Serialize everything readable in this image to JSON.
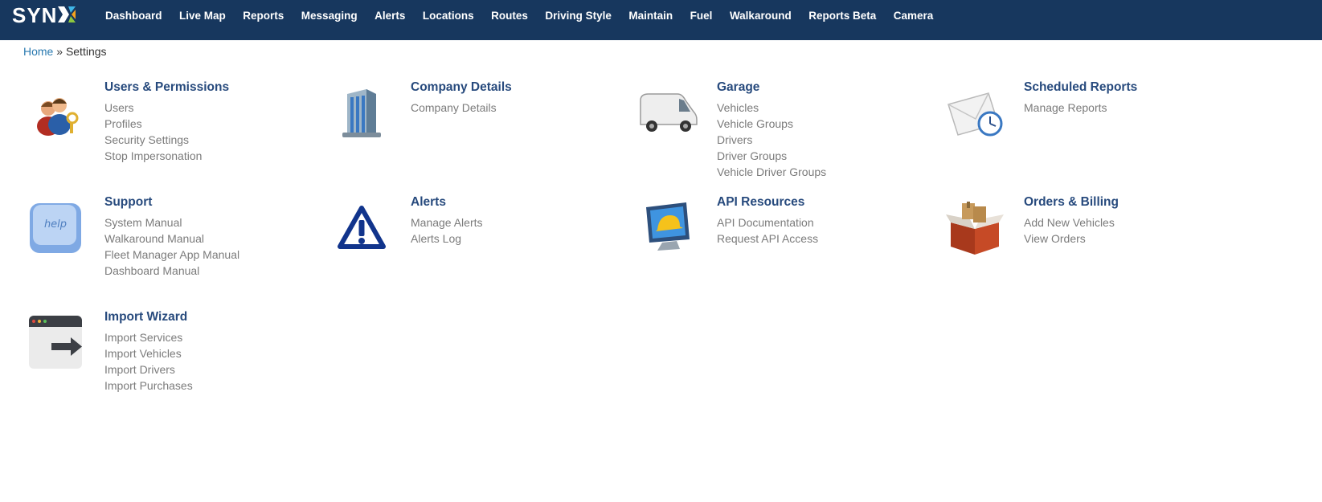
{
  "app": {
    "logo_text": "SYN",
    "nav": [
      "Dashboard",
      "Live Map",
      "Reports",
      "Messaging",
      "Alerts",
      "Locations",
      "Routes",
      "Driving Style",
      "Maintain",
      "Fuel",
      "Walkaround",
      "Reports Beta",
      "Camera"
    ]
  },
  "breadcrumb": {
    "home": "Home",
    "separator": "»",
    "current": "Settings"
  },
  "sections": [
    {
      "id": "users",
      "icon": "users-keys-icon",
      "title": "Users & Permissions",
      "links": [
        "Users",
        "Profiles",
        "Security Settings",
        "Stop Impersonation"
      ]
    },
    {
      "id": "company",
      "icon": "office-building-icon",
      "title": "Company Details",
      "links": [
        "Company Details"
      ]
    },
    {
      "id": "garage",
      "icon": "van-icon",
      "title": "Garage",
      "links": [
        "Vehicles",
        "Vehicle Groups",
        "Drivers",
        "Driver Groups",
        "Vehicle Driver Groups"
      ]
    },
    {
      "id": "scheduled",
      "icon": "envelope-clock-icon",
      "title": "Scheduled Reports",
      "links": [
        "Manage Reports"
      ]
    },
    {
      "id": "support",
      "icon": "help-key-icon",
      "title": "Support",
      "links": [
        "System Manual",
        "Walkaround Manual",
        "Fleet Manager App Manual",
        "Dashboard Manual"
      ]
    },
    {
      "id": "alerts",
      "icon": "warning-triangle-icon",
      "title": "Alerts",
      "links": [
        "Manage Alerts",
        "Alerts Log"
      ]
    },
    {
      "id": "api",
      "icon": "monitor-hardhat-icon",
      "title": "API Resources",
      "links": [
        "API Documentation",
        "Request API Access"
      ]
    },
    {
      "id": "orders",
      "icon": "open-box-icon",
      "title": "Orders & Billing",
      "links": [
        "Add New Vehicles",
        "View Orders"
      ]
    },
    {
      "id": "import",
      "icon": "import-arrow-icon",
      "title": "Import Wizard",
      "links": [
        "Import Services",
        "Import Vehicles",
        "Import Drivers",
        "Import Purchases"
      ]
    }
  ],
  "colors": {
    "nav_bg": "#17375e",
    "title": "#274a7d",
    "link": "#7b7b7b",
    "breadcrumb_link": "#2a7ab0"
  }
}
